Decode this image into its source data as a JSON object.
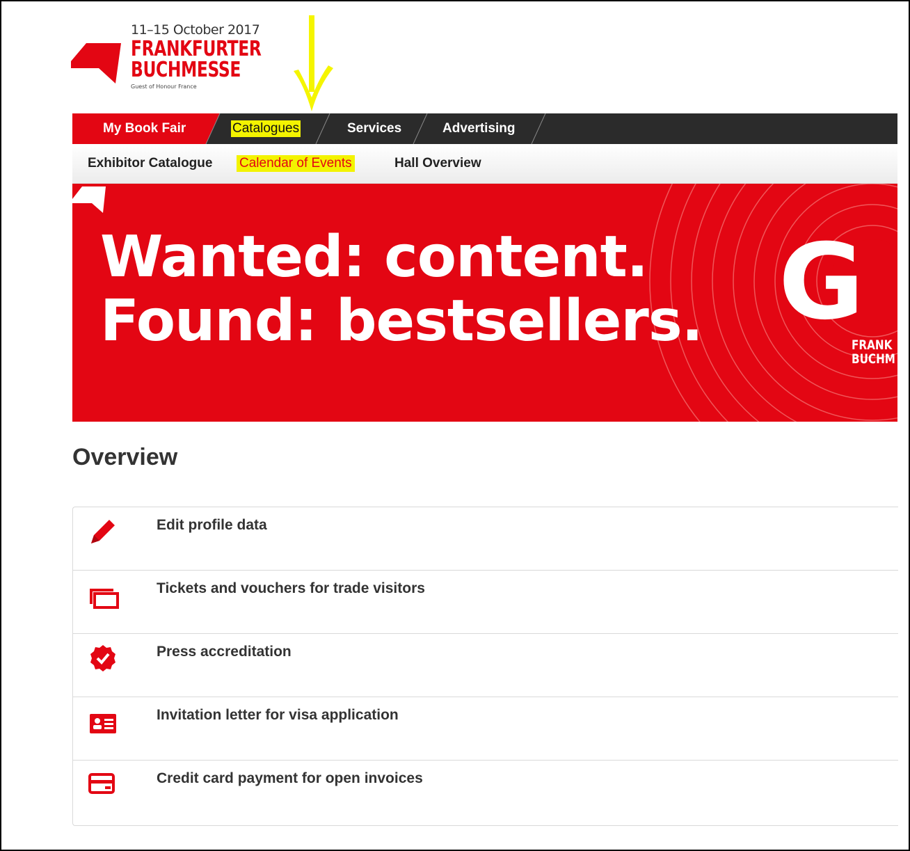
{
  "logo": {
    "date": "11–15 October 2017",
    "line1": "FRANKFURTER",
    "line2": "BUCHMESSE",
    "guest": "Guest of Honour France"
  },
  "colors": {
    "brand": "#e30613",
    "nav_bg": "#2b2b2b",
    "highlight": "#f3f300"
  },
  "main_nav": {
    "items": [
      {
        "label": "My Book Fair",
        "active": true
      },
      {
        "label": "Catalogues",
        "highlighted": true
      },
      {
        "label": "Services"
      },
      {
        "label": "Advertising"
      }
    ]
  },
  "sub_nav": {
    "items": [
      {
        "label": "Exhibitor Catalogue"
      },
      {
        "label": "Calendar of Events",
        "active": true
      },
      {
        "label": "Hall Overview"
      }
    ]
  },
  "banner": {
    "line1": "Wanted: content.",
    "line2": "Found: bestsellers.",
    "big_letter": "G",
    "mini_line1": "FRANK",
    "mini_line2": "BUCHM"
  },
  "overview": {
    "title": "Overview",
    "items": [
      {
        "label": "Edit profile data",
        "icon": "pencil-icon"
      },
      {
        "label": "Tickets and vouchers for trade visitors",
        "icon": "tickets-icon"
      },
      {
        "label": "Press accreditation",
        "icon": "verified-badge-icon"
      },
      {
        "label": "Invitation letter for visa application",
        "icon": "id-card-icon"
      },
      {
        "label": "Credit card payment for open invoices",
        "icon": "credit-card-icon"
      }
    ]
  }
}
